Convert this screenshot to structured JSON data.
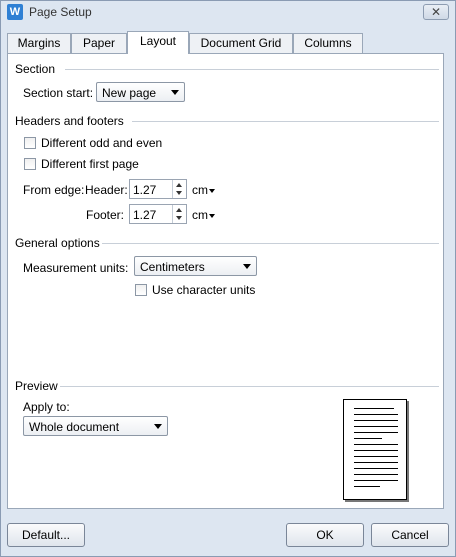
{
  "window": {
    "title": "Page Setup",
    "app_icon_letter": "W",
    "close_glyph": "✕"
  },
  "tabs": [
    "Margins",
    "Paper",
    "Layout",
    "Document Grid",
    "Columns"
  ],
  "section": {
    "heading": "Section",
    "start_label": "Section start:",
    "start_value": "New page"
  },
  "headers_footers": {
    "heading": "Headers and footers",
    "odd_even_label": "Different odd and even",
    "first_page_label": "Different first page",
    "from_edge_label": "From edge:",
    "header_label": "Header:",
    "header_value": "1.27",
    "footer_label": "Footer:",
    "footer_value": "1.27",
    "unit": "cm"
  },
  "general": {
    "heading": "General options",
    "units_label": "Measurement units:",
    "units_value": "Centimeters",
    "char_units_label": "Use character units"
  },
  "preview": {
    "heading": "Preview",
    "apply_label": "Apply to:",
    "apply_value": "Whole document"
  },
  "buttons": {
    "default": "Default...",
    "ok": "OK",
    "cancel": "Cancel"
  }
}
